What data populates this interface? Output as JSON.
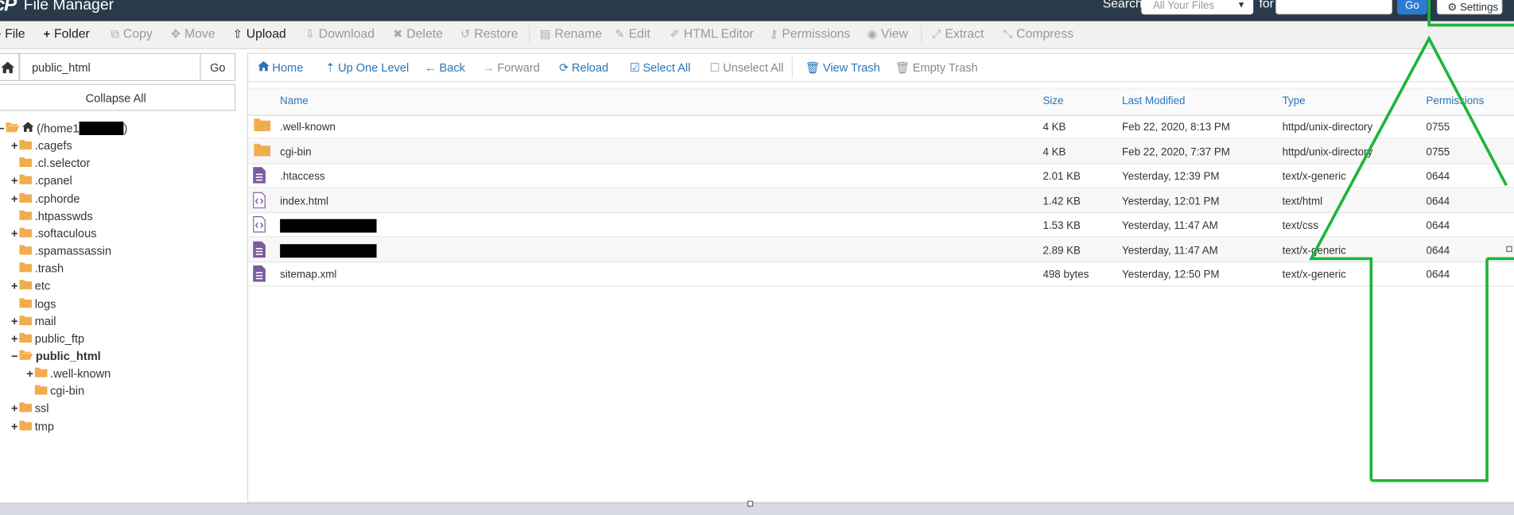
{
  "header": {
    "app_title": "File Manager",
    "logo_text": "cP",
    "search_label": "Search",
    "search_scope": "All Your Files",
    "for_label": "for",
    "search_value": "",
    "go_label": "Go",
    "settings_label": "Settings"
  },
  "toolbar": {
    "items": [
      {
        "label": "File",
        "icon": "plus-icon",
        "enabled": true
      },
      {
        "label": "Folder",
        "icon": "plus-icon",
        "enabled": true
      },
      {
        "label": "Copy",
        "icon": "copy-icon",
        "enabled": false
      },
      {
        "label": "Move",
        "icon": "move-icon",
        "enabled": false
      },
      {
        "label": "Upload",
        "icon": "upload-icon",
        "enabled": true
      },
      {
        "label": "Download",
        "icon": "download-icon",
        "enabled": false
      },
      {
        "label": "Delete",
        "icon": "delete-icon",
        "enabled": false
      },
      {
        "label": "Restore",
        "icon": "restore-icon",
        "enabled": false
      },
      {
        "label": "Rename",
        "icon": "file-icon",
        "enabled": false
      },
      {
        "label": "Edit",
        "icon": "pencil-icon",
        "enabled": false
      },
      {
        "label": "HTML Editor",
        "icon": "edit-icon",
        "enabled": false
      },
      {
        "label": "Permissions",
        "icon": "key-icon",
        "enabled": false
      },
      {
        "label": "View",
        "icon": "eye-icon",
        "enabled": false
      },
      {
        "label": "Extract",
        "icon": "expand-icon",
        "enabled": false
      },
      {
        "label": "Compress",
        "icon": "compress-icon",
        "enabled": false
      }
    ]
  },
  "sidebar": {
    "path_value": "public_html",
    "go_label": "Go",
    "collapse_label": "Collapse All",
    "tree": [
      {
        "label": "(/home1",
        "suffix": ")",
        "expander": "−",
        "kind": "root",
        "redacted": true
      },
      {
        "label": ".cagefs",
        "expander": "+"
      },
      {
        "label": ".cl.selector",
        "expander": ""
      },
      {
        "label": ".cpanel",
        "expander": "+"
      },
      {
        "label": ".cphorde",
        "expander": "+"
      },
      {
        "label": ".htpasswds",
        "expander": ""
      },
      {
        "label": ".softaculous",
        "expander": "+"
      },
      {
        "label": ".spamassassin",
        "expander": ""
      },
      {
        "label": ".trash",
        "expander": ""
      },
      {
        "label": "etc",
        "expander": "+"
      },
      {
        "label": "logs",
        "expander": ""
      },
      {
        "label": "mail",
        "expander": "+"
      },
      {
        "label": "public_ftp",
        "expander": "+"
      },
      {
        "label": "public_html",
        "expander": "−",
        "bold": true,
        "open": true
      },
      {
        "label": ".well-known",
        "expander": "+",
        "child": true
      },
      {
        "label": "cgi-bin",
        "expander": "",
        "child": true
      },
      {
        "label": "ssl",
        "expander": "+"
      },
      {
        "label": "tmp",
        "expander": "+"
      }
    ]
  },
  "navbar": {
    "items": [
      {
        "label": "Home",
        "icon": "home-icon",
        "enabled": true
      },
      {
        "label": "Up One Level",
        "icon": "level-up-icon",
        "enabled": true
      },
      {
        "label": "Back",
        "icon": "arrow-left-icon",
        "enabled": true
      },
      {
        "label": "Forward",
        "icon": "arrow-right-icon",
        "enabled": false
      },
      {
        "label": "Reload",
        "icon": "reload-icon",
        "enabled": true
      },
      {
        "label": "Select All",
        "icon": "checkbox-checked-icon",
        "enabled": true
      },
      {
        "label": "Unselect All",
        "icon": "checkbox-empty-icon",
        "enabled": false
      },
      {
        "label": "View Trash",
        "icon": "trash-icon",
        "enabled": true
      },
      {
        "label": "Empty Trash",
        "icon": "trash-icon",
        "enabled": false
      }
    ]
  },
  "table": {
    "columns": [
      "Name",
      "Size",
      "Last Modified",
      "Type",
      "Permissions"
    ],
    "rows": [
      {
        "name": ".well-known",
        "size": "4 KB",
        "modified": "Feb 22, 2020, 8:13 PM",
        "type": "httpd/unix-directory",
        "perms": "0755",
        "icon": "folder-icon"
      },
      {
        "name": "cgi-bin",
        "size": "4 KB",
        "modified": "Feb 22, 2020, 7:37 PM",
        "type": "httpd/unix-directory",
        "perms": "0755",
        "icon": "folder-icon"
      },
      {
        "name": ".htaccess",
        "size": "2.01 KB",
        "modified": "Yesterday, 12:39 PM",
        "type": "text/x-generic",
        "perms": "0644",
        "icon": "text-file-icon"
      },
      {
        "name": "index.html",
        "size": "1.42 KB",
        "modified": "Yesterday, 12:01 PM",
        "type": "text/html",
        "perms": "0644",
        "icon": "code-file-icon"
      },
      {
        "name": "",
        "redacted": true,
        "size": "1.53 KB",
        "modified": "Yesterday, 11:47 AM",
        "type": "text/css",
        "perms": "0644",
        "icon": "code-file-icon"
      },
      {
        "name": "",
        "redacted": true,
        "size": "2.89 KB",
        "modified": "Yesterday, 11:47 AM",
        "type": "text/x-generic",
        "perms": "0644",
        "icon": "text-file-icon"
      },
      {
        "name": "sitemap.xml",
        "size": "498 bytes",
        "modified": "Yesterday, 12:50 PM",
        "type": "text/x-generic",
        "perms": "0644",
        "icon": "text-file-icon"
      }
    ]
  },
  "colors": {
    "header_bg": "#293a4a",
    "link_blue": "#2a74b8",
    "folder_orange": "#f0ad4e",
    "file_purple": "#7a5a9e",
    "annotation_green": "#1db53a"
  }
}
